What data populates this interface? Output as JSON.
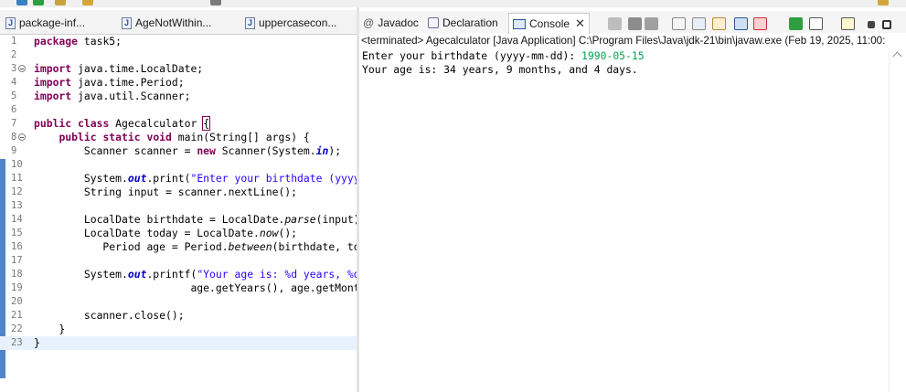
{
  "editor": {
    "tabs": [
      {
        "label": "package-inf...",
        "icon": "java-file-icon"
      },
      {
        "label": "AgeNotWithin...",
        "icon": "java-file-icon"
      },
      {
        "label": "uppercasecon...",
        "icon": "java-file-icon"
      }
    ],
    "lines": [
      {
        "n": "1",
        "html": "<span class='kw'>package</span> task5;"
      },
      {
        "n": "2",
        "html": ""
      },
      {
        "n": "3",
        "html": "<span class='kw'>import</span> java.time.LocalDate;",
        "fold": true
      },
      {
        "n": "4",
        "html": "<span class='kw'>import</span> java.time.Period;"
      },
      {
        "n": "5",
        "html": "<span class='kw'>import</span> java.util.Scanner;"
      },
      {
        "n": "6",
        "html": ""
      },
      {
        "n": "7",
        "html": "<span class='kw'>public</span> <span class='kw'>class</span> Agecalculator <span class='brk'>{</span>"
      },
      {
        "n": "8",
        "html": "    <span class='kw'>public</span> <span class='kw'>static</span> <span class='kw'>void</span> main(String[] args) {",
        "fold": true
      },
      {
        "n": "9",
        "html": "        Scanner scanner = <span class='kw'>new</span> Scanner(System.<span class='fld'>in</span>);"
      },
      {
        "n": "10",
        "html": ""
      },
      {
        "n": "11",
        "html": "        System.<span class='fld'>out</span>.print(<span class='str'>\"Enter your birthdate (yyyy-mm-dd): \"</span>);"
      },
      {
        "n": "12",
        "html": "        String input = scanner.nextLine();"
      },
      {
        "n": "13",
        "html": ""
      },
      {
        "n": "14",
        "html": "        LocalDate birthdate = LocalDate.<span class='mth'>parse</span>(input);"
      },
      {
        "n": "15",
        "html": "        LocalDate today = LocalDate.<span class='mth'>now</span>();"
      },
      {
        "n": "16",
        "html": "           Period age = Period.<span class='mth'>between</span>(birthdate, today);"
      },
      {
        "n": "17",
        "html": ""
      },
      {
        "n": "18",
        "html": "        System.<span class='fld'>out</span>.printf(<span class='str'>\"Your age is: %d years, %d months, and %d days.\"</span>,"
      },
      {
        "n": "19",
        "html": "                         age.getYears(), age.getMonths(), age.getDays());"
      },
      {
        "n": "20",
        "html": ""
      },
      {
        "n": "21",
        "html": "        scanner.close();"
      },
      {
        "n": "22",
        "html": "    }"
      },
      {
        "n": "23",
        "html": "}",
        "current": true
      }
    ]
  },
  "console_view": {
    "tabs": [
      {
        "label": "Javadoc",
        "icon": "at-icon"
      },
      {
        "label": "Declaration",
        "icon": "declaration-icon"
      },
      {
        "label": "Console",
        "icon": "console-icon",
        "active": true
      }
    ],
    "status": "<terminated> Agecalculator [Java Application] C:\\Program Files\\Java\\jdk-21\\bin\\javaw.exe  (Feb 19, 2025, 11:00:",
    "output": [
      {
        "prompt": "Enter your birthdate (yyyy-mm-dd): ",
        "input": "1990-05-15"
      },
      {
        "prompt": "Your age is: 34 years, 9 months, and 4 days.",
        "input": ""
      }
    ],
    "colors": {
      "user_input": "#00a651",
      "keyword": "#7f0055",
      "string": "#2a00ff"
    }
  }
}
